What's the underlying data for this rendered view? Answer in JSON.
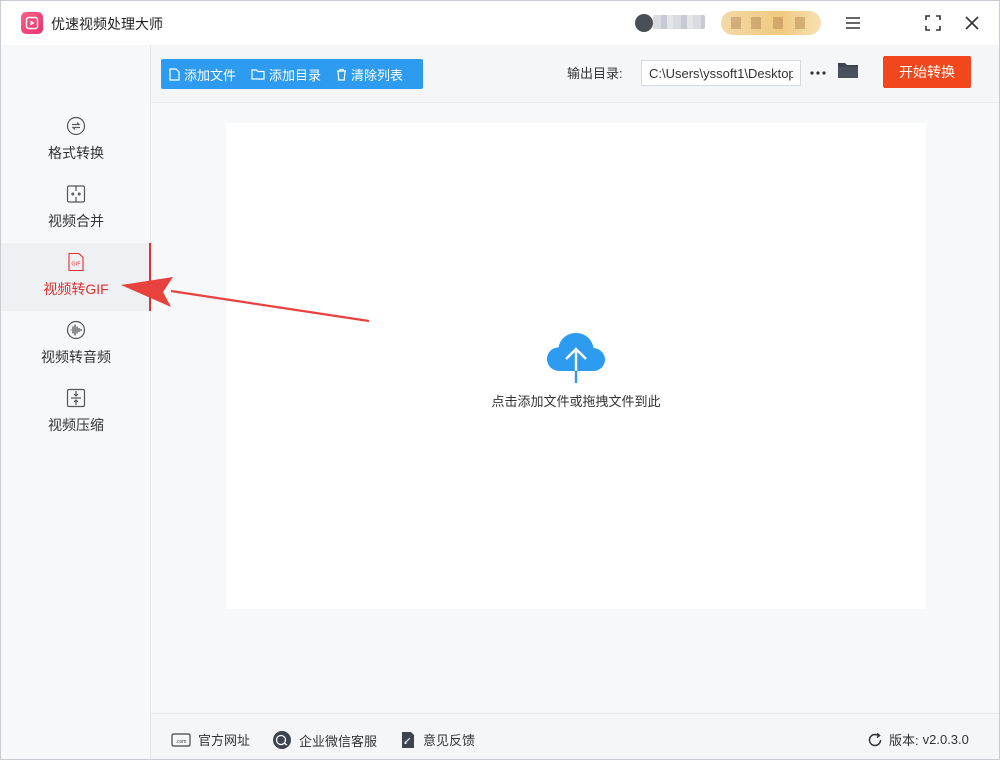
{
  "app": {
    "title": "优速视频处理大师"
  },
  "sidebar": {
    "items": [
      {
        "label": "格式转换",
        "icon": "format-convert-icon",
        "active": false
      },
      {
        "label": "视频合并",
        "icon": "merge-icon",
        "active": false
      },
      {
        "label": "视频转GIF",
        "icon": "gif-icon",
        "active": true
      },
      {
        "label": "视频转音频",
        "icon": "audio-icon",
        "active": false
      },
      {
        "label": "视频压缩",
        "icon": "compress-icon",
        "active": false
      }
    ]
  },
  "toolbar": {
    "add_file": "添加文件",
    "add_dir": "添加目录",
    "clear_list": "清除列表",
    "output_label": "输出目录:",
    "output_path": "C:\\Users\\yssoft1\\Desktop",
    "more": "···",
    "start": "开始转换"
  },
  "dropzone": {
    "text": "点击添加文件或拖拽文件到此"
  },
  "footer": {
    "website": "官方网址",
    "wechat": "企业微信客服",
    "feedback": "意见反馈",
    "version_label": "版本:",
    "version": "v2.0.3.0"
  },
  "colors": {
    "accent_blue": "#2d9cf0",
    "start_red": "#f2471c",
    "active_red": "#e0312f",
    "annotation_red": "#e8423f"
  }
}
